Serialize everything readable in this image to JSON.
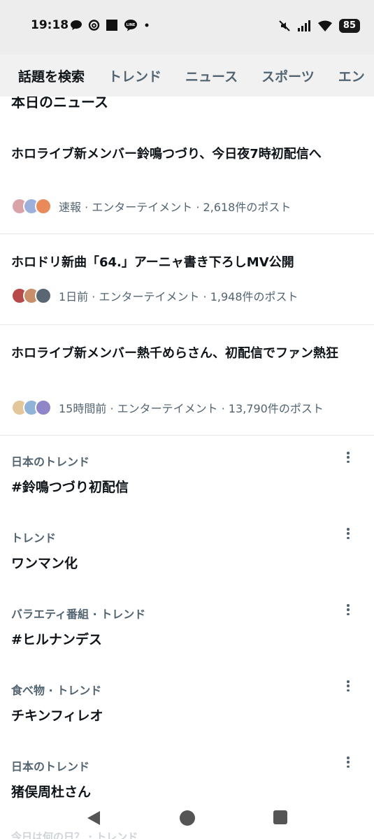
{
  "status_bar": {
    "time": "19:18",
    "battery": "85",
    "left_icons": [
      "chat-bubble-icon",
      "threads-icon",
      "black-square-icon",
      "line-app-icon",
      "dot-icon"
    ],
    "right_icons": [
      "mute-icon",
      "signal-icon",
      "wifi-icon",
      "battery-icon"
    ],
    "line_label": "LINE"
  },
  "tabs": [
    {
      "label": "話題を検索",
      "active": true
    },
    {
      "label": "トレンド",
      "active": false
    },
    {
      "label": "ニュース",
      "active": false
    },
    {
      "label": "スポーツ",
      "active": false
    },
    {
      "label": "エン",
      "active": false
    }
  ],
  "section_title": "本日のニュース",
  "news": [
    {
      "headline": "ホロライブ新メンバー鈴鳴つづり、今日夜7時初配信へ",
      "meta": "速報 · エンターテイメント · 2,618件のポスト",
      "avatar_colors": [
        "#d9a3a8",
        "#9db0dc",
        "#e88a5a"
      ]
    },
    {
      "headline": "ホロドリ新曲「64.」アーニャ書き下ろしMV公開",
      "meta": "1日前 · エンターテイメント · 1,948件のポスト",
      "avatar_colors": [
        "#b84a4a",
        "#c98e6a",
        "#5b6673"
      ]
    },
    {
      "headline": "ホロライブ新メンバー熱千めらさん、初配信でファン熱狂",
      "meta": "15時間前 · エンターテイメント · 13,790件のポスト",
      "avatar_colors": [
        "#e4c69b",
        "#8fb4d8",
        "#8e86c9"
      ]
    }
  ],
  "trends": [
    {
      "category": "日本のトレンド",
      "name": "#鈴鳴つづり初配信"
    },
    {
      "category": "トレンド",
      "name": "ワンマン化"
    },
    {
      "category": "バラエティ番組 · トレンド",
      "name": "#ヒルナンデス"
    },
    {
      "category": "食べ物 · トレンド",
      "name": "チキンフィレオ"
    },
    {
      "category": "日本のトレンド",
      "name": "猪俣周杜さん"
    }
  ],
  "peek_text": "今日は何の日？ · トレンド",
  "nav": [
    "back-icon",
    "home-icon",
    "recents-icon"
  ],
  "colors": {
    "primary_text": "#0f1419",
    "secondary_text": "#536471",
    "divider": "#e6e9eb"
  }
}
